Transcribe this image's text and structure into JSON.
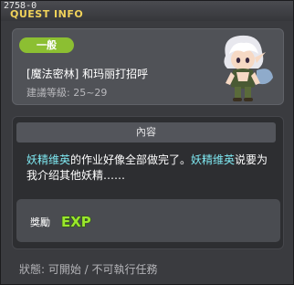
{
  "window": {
    "quest_id": "2758-0",
    "title": "QUEST INFO"
  },
  "quest": {
    "category_badge": "一般",
    "name": "[魔法密林] 和玛丽打招呼",
    "recommended_level": "建議等級: 25~29"
  },
  "content": {
    "header": "內容",
    "segments": [
      {
        "text": "妖精维英",
        "highlight": true
      },
      {
        "text": "的作业好像全部做完了。",
        "highlight": false
      },
      {
        "text": "妖精维英",
        "highlight": true
      },
      {
        "text": "说要为我介绍其他妖精……",
        "highlight": false
      }
    ]
  },
  "reward": {
    "label": "獎勵",
    "icon": "exp-icon",
    "icon_text": "EXP"
  },
  "status": {
    "text": "狀態: 可開始 / 不可執行任務"
  },
  "colors": {
    "title": "#f0d25a",
    "badge": "#8cbf32",
    "highlight": "#7ee7f0"
  }
}
